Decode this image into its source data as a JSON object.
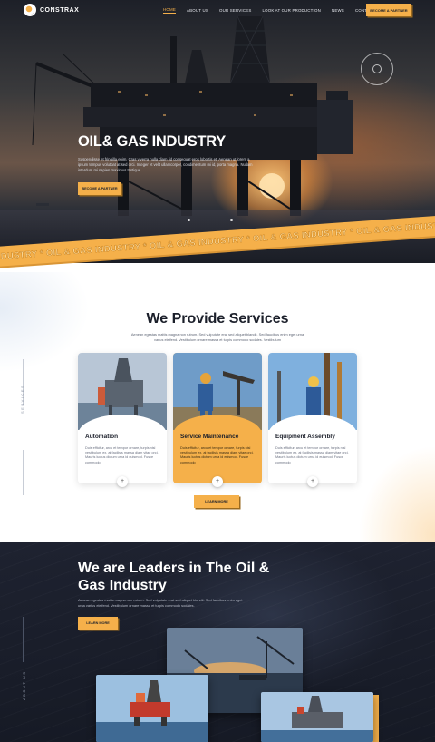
{
  "brand": {
    "name": "CONSTRAX"
  },
  "nav": {
    "links": [
      "HOME",
      "ABOUT US",
      "OUR SERVICES",
      "LOOK AT OUR PRODUCTION",
      "NEWS",
      "CONTACT"
    ],
    "active_index": 0,
    "cta": "BECOME A PARTNER"
  },
  "hero": {
    "title": "OIL& GAS INDUSTRY",
    "text": "Suspendisse et fringilla enim. Cras viverra nulla diam, id consequat eros lobortis et. Aenean ut lorem a ipsum tempus volutpat at sed orci. Integer et velit ullamcorper, condimentum mi id, porta magna. Nullam interdum mi sapien maximus tristique.",
    "cta": "BECOME A PARTNER",
    "badge_icon": "circular-badge-icon"
  },
  "ribbon": {
    "text": "INDUSTRY * OIL & GAS INDUSTRY * OIL & GAS INDUSTRY * OIL & GAS INDUSTRY * OIL & GAS INDUSTRY *"
  },
  "services": {
    "side_label": "SERVICES",
    "title": "We Provide Services",
    "subtitle": "Aenean egestas mattis magna non rutrum. Sed vulputate erat sed aliquet blandit. Sed faucibus enim eget urna varius eleifend. Vestibulum ornare massa et turpis commodo sodales. Vestibulum",
    "cards": [
      {
        "title": "Automation",
        "text": "Duis efficitur, arcu et tempor ornare, turpis nisl vestibulum ex, at facilisis massa diam vitae orci. Mauris luctus dictum urna id euismod. Fusce commodo"
      },
      {
        "title": "Service Maintenance",
        "text": "Duis efficitur, arcu et tempor ornare, turpis nisl vestibulum ex, at facilisis massa diam vitae orci. Mauris luctus dictum urna id euismod. Fusce commodo"
      },
      {
        "title": "Equipment Assembly",
        "text": "Duis efficitur, arcu et tempor ornare, turpis nisl vestibulum ex, at facilisis massa diam vitae orci. Mauris luctus dictum urna id euismod. Fusce commodo"
      }
    ],
    "cta": "LEARN MORE"
  },
  "leaders": {
    "side_label": "ABOUT US",
    "title": "We are Leaders in The Oil & Gas Industry",
    "text": "Aenean egestas mattis magna non rutrum. Sed vulputate erat sed aliquet blandit. Sed faucibus enim eget urna varius eleifend. Vestibulum ornare massa et turpis commodo sodales.",
    "cta": "LEARN MORE"
  },
  "colors": {
    "accent": "#f5b04a",
    "dark": "#1b1f2a"
  }
}
